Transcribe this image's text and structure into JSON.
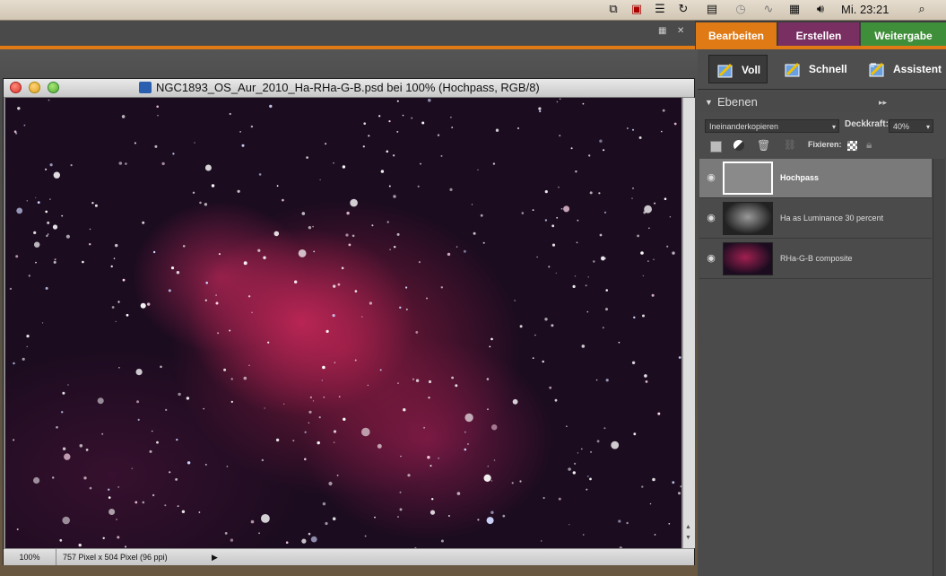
{
  "menubar": {
    "clock": "Mi. 23:21",
    "icons": [
      "screen-share-icon",
      "monitor-icon",
      "notes-icon",
      "sync-icon",
      "stats-icon",
      "time-machine-icon",
      "activity-icon",
      "calendar-icon",
      "volume-icon",
      "spotlight-icon"
    ]
  },
  "tabs": {
    "edit": "Bearbeiten",
    "create": "Erstellen",
    "share": "Weitergabe"
  },
  "colors": {
    "accent_orange": "#e07a14",
    "tab_create": "#7a2f63",
    "tab_share": "#3f8f3a"
  },
  "modes": {
    "full": "Voll",
    "quick": "Schnell",
    "guided": "Assistent"
  },
  "layers_panel": {
    "title": "Ebenen",
    "blend_mode": "Ineinanderkopieren",
    "opacity_label": "Deckkraft:",
    "opacity_value": "40%",
    "lock_label": "Fixieren:",
    "layers": [
      {
        "name": "Hochpass",
        "selected": true
      },
      {
        "name": "Ha as Luminance 30 percent",
        "selected": false
      },
      {
        "name": "RHa-G-B composite",
        "selected": false
      }
    ]
  },
  "document": {
    "title": "NGC1893_OS_Aur_2010_Ha-RHa-G-B.psd bei 100% (Hochpass, RGB/8)",
    "zoom": "100%",
    "info": "757 Pixel x 504 Pixel (96 ppi)"
  }
}
